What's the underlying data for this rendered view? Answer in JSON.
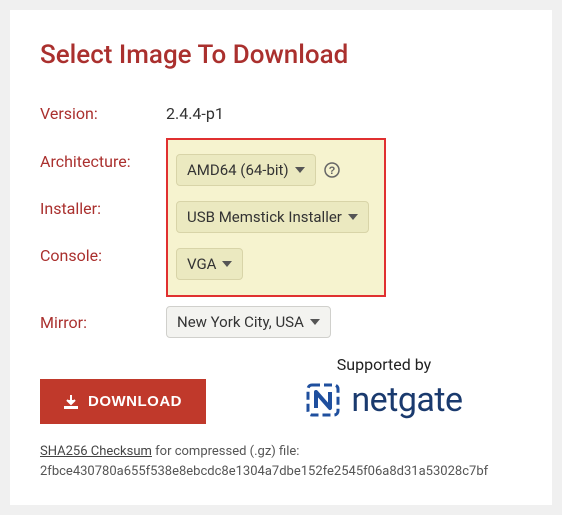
{
  "title": "Select Image To Download",
  "fields": {
    "version_label": "Version:",
    "version_value": "2.4.4-p1",
    "architecture_label": "Architecture:",
    "architecture_value": "AMD64 (64-bit)",
    "installer_label": "Installer:",
    "installer_value": "USB Memstick Installer",
    "console_label": "Console:",
    "console_value": "VGA",
    "mirror_label": "Mirror:",
    "mirror_value": "New York City, USA"
  },
  "download_button": "DOWNLOAD",
  "supported_by_label": "Supported by",
  "brand": "netgate",
  "checksum_link": "SHA256 Checksum",
  "checksum_suffix": " for compressed (.gz) file:",
  "checksum_hash": "2fbce430780a655f538e8ebcdc8e1304a7dbe152fe2545f06a8d31a53028c7bf",
  "icons": {
    "help": "help-icon",
    "chevron": "chevron-down-icon",
    "download": "download-icon",
    "netgate_logo": "netgate-logo-icon"
  }
}
